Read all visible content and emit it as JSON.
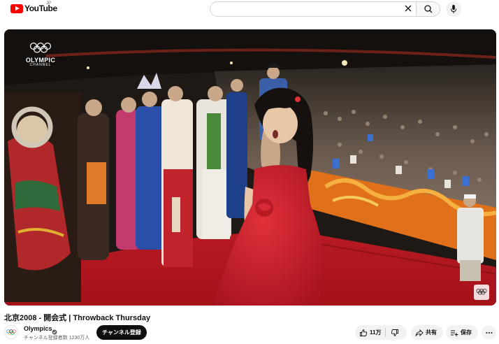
{
  "header": {
    "logo_text": "YouTube",
    "country_code": "JP",
    "search": {
      "value": "",
      "placeholder": ""
    },
    "icons": [
      "youtube-logo-icon",
      "clear-search-icon",
      "search-icon",
      "mic-icon"
    ]
  },
  "video": {
    "channel_watermark": "OLYMPIC",
    "channel_watermark_sub": "CHANNEL",
    "title": "北京2008 - 開会式 | Throwback Thursday"
  },
  "channel": {
    "name": "Olympics",
    "subscribers": "チャンネル登録者数 1230万人",
    "subscribe_label": "チャンネル登録"
  },
  "actions": {
    "like_count": "11万",
    "share_label": "共有",
    "save_label": "保存"
  },
  "colors": {
    "brand_red": "#ff0000",
    "subscribe_bg": "#0f0f0f",
    "pill_bg": "#f2f2f2",
    "dress_red": "#c81f2c"
  }
}
